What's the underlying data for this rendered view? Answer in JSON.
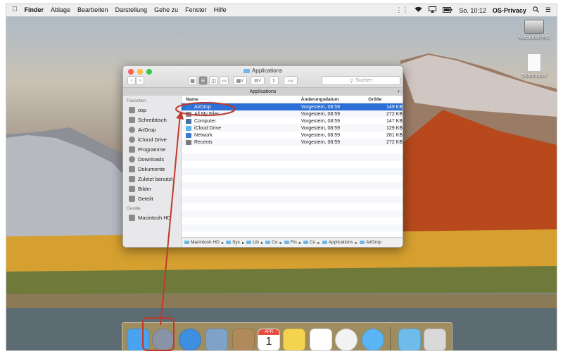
{
  "menubar": {
    "app": "Finder",
    "items": [
      "Ablage",
      "Bearbeiten",
      "Darstellung",
      "Gehe zu",
      "Fenster",
      "Hilfe"
    ],
    "clock": "So. 10:12",
    "user": "OS-Privacy"
  },
  "desktop": {
    "icons": [
      {
        "label": "Macintosh HD",
        "icon": "hard-drive-icon"
      },
      {
        "label": "Screenshot",
        "icon": "document-icon"
      }
    ]
  },
  "window": {
    "title": "Applications",
    "path_tab": "Applications",
    "search_placeholder": "Suchen",
    "sidebar": {
      "favorites_header": "Favoriten",
      "favorites": [
        {
          "label": "osp",
          "icon": "home-icon"
        },
        {
          "label": "Schreibtisch",
          "icon": "desktop-icon"
        },
        {
          "label": "AirDrop",
          "icon": "airdrop-icon"
        },
        {
          "label": "iCloud Drive",
          "icon": "cloud-icon"
        },
        {
          "label": "Programme",
          "icon": "apps-icon"
        },
        {
          "label": "Downloads",
          "icon": "download-icon"
        },
        {
          "label": "Dokumente",
          "icon": "document-icon"
        },
        {
          "label": "Zuletzt benutzt",
          "icon": "clock-icon"
        },
        {
          "label": "Bilder",
          "icon": "camera-icon"
        },
        {
          "label": "Geteilt",
          "icon": "folder-icon"
        }
      ],
      "devices_header": "Geräte",
      "devices": [
        {
          "label": "Macintosh HD",
          "icon": "hard-drive-icon"
        }
      ]
    },
    "columns": [
      "Name",
      "Änderungsdatum",
      "Größe"
    ],
    "files": [
      {
        "name": "AirDrop",
        "date": "Vorgestern, 08:59",
        "size": "149 KB",
        "selected": true,
        "color": "#2a7be0"
      },
      {
        "name": "All My Files",
        "date": "Vorgestern, 08:59",
        "size": "272 KB",
        "selected": false,
        "color": "#8a8a8a"
      },
      {
        "name": "Computer",
        "date": "Vorgestern, 08:59",
        "size": "147 KB",
        "selected": false,
        "color": "#4a6fa5"
      },
      {
        "name": "iCloud Drive",
        "date": "Vorgestern, 08:59",
        "size": "129 KB",
        "selected": false,
        "color": "#5fb2ee"
      },
      {
        "name": "Network",
        "date": "Vorgestern, 08:59",
        "size": "281 KB",
        "selected": false,
        "color": "#3c7ad0"
      },
      {
        "name": "Recents",
        "date": "Vorgestern, 08:59",
        "size": "272 KB",
        "selected": false,
        "color": "#7a7a7a"
      }
    ],
    "pathbar": [
      "Macintosh HD",
      "Sys",
      "Lib",
      "Co",
      "Fin",
      "Co",
      "Applications",
      "AirDrop"
    ]
  },
  "dock": {
    "apps": [
      {
        "name": "finder-icon",
        "color": "#4aa3ee"
      },
      {
        "name": "airdrop-icon",
        "color": "#8a93a5"
      },
      {
        "name": "safari-icon",
        "color": "#3f8fe0"
      },
      {
        "name": "preview-icon",
        "color": "#7fa3c8"
      },
      {
        "name": "contacts-icon",
        "color": "#b08a5a"
      },
      {
        "name": "calendar-icon",
        "color": "#ffffff"
      },
      {
        "name": "notes-icon",
        "color": "#f4d34f"
      },
      {
        "name": "reminders-icon",
        "color": "#ffffff"
      },
      {
        "name": "photos-icon",
        "color": "#f2f2f2"
      },
      {
        "name": "messages-icon",
        "color": "#5ab4f5"
      },
      {
        "name": "downloads-folder-icon",
        "color": "#6fbbe9"
      },
      {
        "name": "trash-icon",
        "color": "#d9d9d9"
      }
    ],
    "calendar": {
      "month": "APR",
      "day": "1"
    }
  },
  "accent": "#c0392b"
}
